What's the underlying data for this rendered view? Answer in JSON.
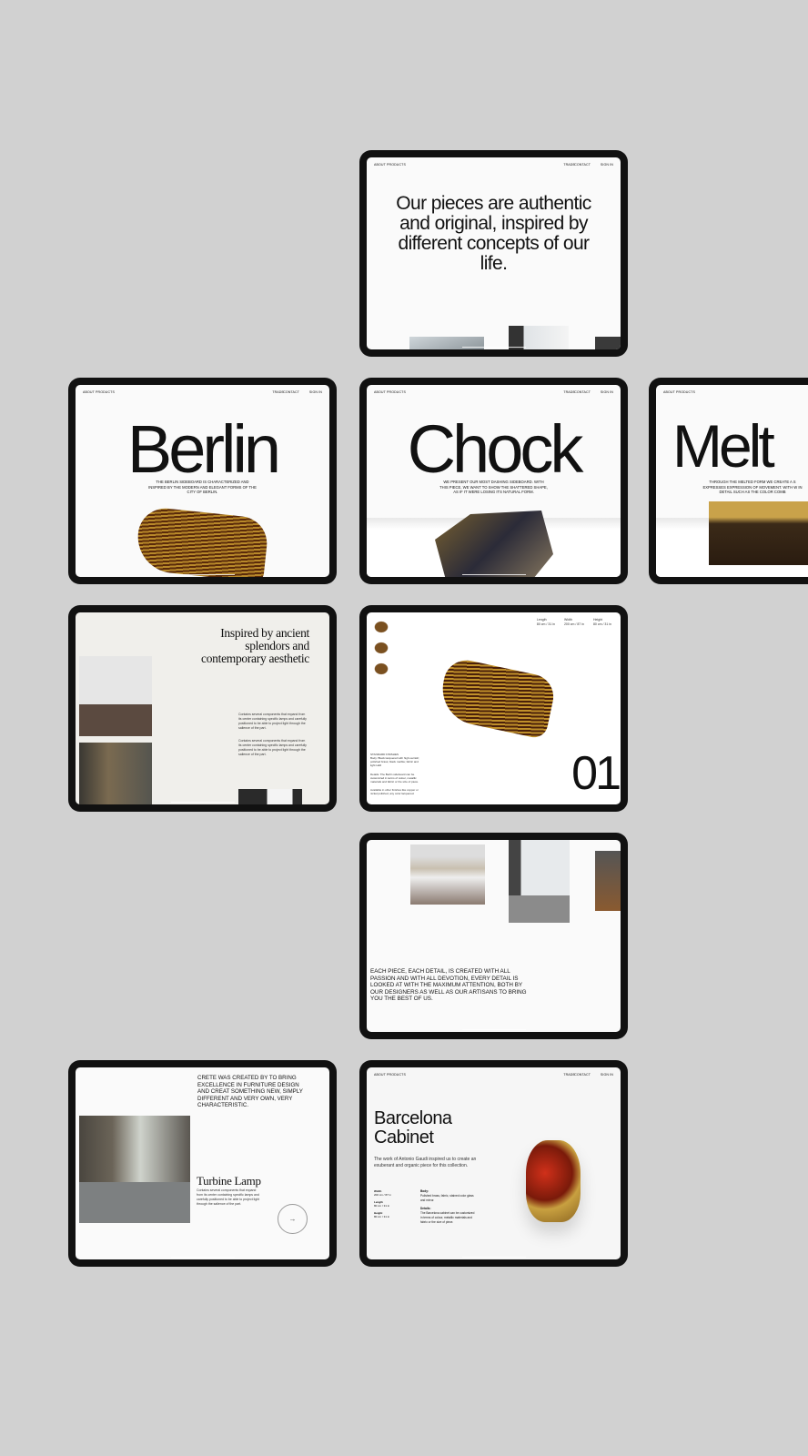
{
  "nav": {
    "about": "ABOUT",
    "products": "PRODUCTS",
    "trade": "TRADE",
    "contact": "CONTACT",
    "signin": "SIGN IN"
  },
  "intro": {
    "headline": "Our pieces are authentic and original, inspired by different concepts of our life."
  },
  "berlin": {
    "title": "Berlin",
    "description": "THE BERLIN SIDEBOARD IS CHARACTERIZED AND INSPIRED BY THE MODERN AND ELEGANT FORMS OF THE CITY OF BERLIN."
  },
  "chock": {
    "title": "Chock",
    "description": "WE PRESENT OUR MOST DASHING SIDEBOARD. WITH THIS PIECE, WE WANT TO SHOW THE SHATTERED SHAPE, AS IF IT WERE LOSING ITS NATURAL FORM."
  },
  "melt": {
    "title": "Melt",
    "description": "THROUGH THE MELTED FORM WE CREATE A S EXPRESSES EXPRESSION OF MOVEMENT. WITH W IN DETAIL SUCH AS THE COLOR COMB"
  },
  "inspired": {
    "headline": "Inspired by ancient splendors and contemporary aesthetic",
    "paragraph1": "Contains several components that expand from its center containing specific lamps and carefully positioned to be able to project light through the salience of the part.",
    "paragraph2": "Contains several components that expand from its center containing specific lamps and carefully positioned to be able to project light through the salience of the part."
  },
  "product": {
    "number": "01",
    "specs": [
      {
        "label": "Length",
        "value": "80 cm / 31 in"
      },
      {
        "label": "Width",
        "value": "200 cm / 87 in"
      },
      {
        "label": "Height",
        "value": "80 cm / 31 in"
      }
    ],
    "finishes_label": "STANDARD FINISHES",
    "finishes": "Body: Black lacquered with high-varnish; polished brass; black marble; fabric and light LED",
    "details": "Details: The Berlin sideboard can be customized in terms of colour, metallic materials and fabric or the size of piece.",
    "available": "Available in other finishes like copper or nickel polished, any color lacquered."
  },
  "gallery": {
    "statement": "EACH PIECE, EACH DETAIL, IS CREATED WITH ALL PASSION AND WITH ALL DEVOTION, EVERY DETAIL IS LOOKED AT WITH THE MAXIMUM ATTENTION, BOTH BY OUR DESIGNERS AS WELL AS OUR ARTISANS TO BRING YOU THE BEST OF US."
  },
  "turbine": {
    "intro": "CRETE WAS CREATED BY TO BRING EXCELLENCE IN FURNITURE DESIGN AND CREAT SOMETHING NEW, SIMPLY DIFFERENT AND VERY OWN, VERY CHARACTERISTIC.",
    "title": "Turbine Lamp",
    "description": "Contains several components that expand from its center containing specific lamps and carefully positioned to be able to project light through the salience of the part.",
    "next_icon": "arrow-right-icon"
  },
  "barcelona": {
    "title": "Barcelona Cabinet",
    "description": "The work of Antonio Gaudi inspired us to create an exuberant and organic piece for this collection.",
    "specs": [
      {
        "label": "Width",
        "value": "200 cm / 87 in"
      },
      {
        "label": "Length",
        "value": "80 cm / 31 in"
      },
      {
        "label": "Height",
        "value": "80 cm / 31 in"
      }
    ],
    "body_label": "Body:",
    "body": "Polished brass, fabric, stained color glass and mirror.",
    "details_label": "Details:",
    "details": "The Barcelona cabinet can be customized in terms of colour, metallic materials and fabric or the size of piece."
  },
  "colors": {
    "background": "#d1d1d1",
    "bezel": "#111111",
    "gold": "#b8892a"
  }
}
